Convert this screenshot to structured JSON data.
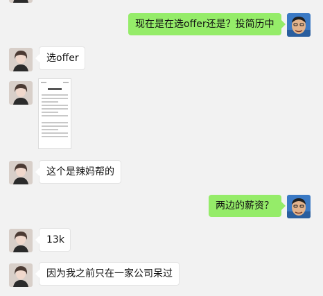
{
  "messages": [
    {
      "side": "out",
      "text": "现在是在选offer还是？投简历中"
    },
    {
      "side": "in",
      "text": "选offer"
    },
    {
      "side": "in",
      "type": "image"
    },
    {
      "side": "in",
      "text": "这个是辣妈帮的"
    },
    {
      "side": "out",
      "text": "两边的薪资？"
    },
    {
      "side": "in",
      "text": "13k"
    },
    {
      "side": "in",
      "text": "因为我之前只在一家公司呆过"
    }
  ],
  "colors": {
    "background": "#f2f2f2",
    "incoming_bubble": "#ffffff",
    "outgoing_bubble": "#95ec69"
  },
  "icons": {
    "incoming_avatar": "woman-avatar-icon",
    "outgoing_avatar": "man-avatar-icon"
  }
}
